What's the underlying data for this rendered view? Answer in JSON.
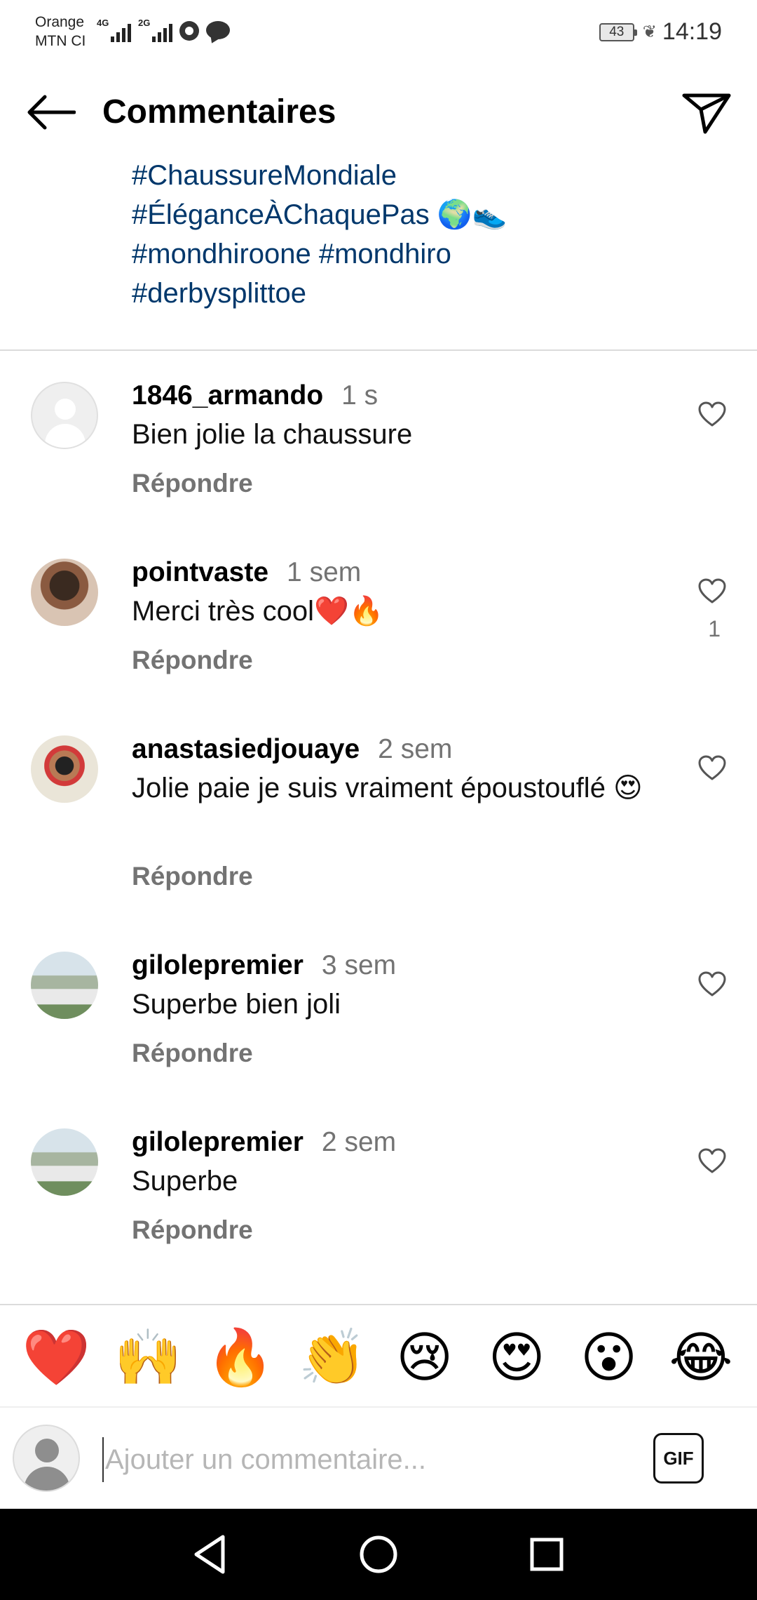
{
  "status_bar": {
    "carrier_line1": "Orange",
    "carrier_line2": "MTN CI",
    "net1": "4G",
    "net2": "2G",
    "battery": "43",
    "time": "14:19"
  },
  "header": {
    "title": "Commentaires"
  },
  "caption": {
    "lines": [
      "#ChaussureMondiale",
      "#ÉléganceÀChaquePas 🌍👟",
      "#mondhiroone #mondhiro",
      "#derbysplittoe"
    ]
  },
  "comments": [
    {
      "username": "1846_armando",
      "time": "1 s",
      "text": "Bien jolie la chaussure",
      "reply": "Répondre",
      "likes": ""
    },
    {
      "username": "pointvaste",
      "time": "1 sem",
      "text": "Merci très cool❤️🔥",
      "reply": "Répondre",
      "likes": "1"
    },
    {
      "username": "anastasiedjouaye",
      "time": "2 sem",
      "text": "Jolie paie je suis vraiment époustouflé 😍",
      "reply": "Répondre",
      "likes": ""
    },
    {
      "username": "gilolepremier",
      "time": "3 sem",
      "text": "Superbe bien joli",
      "reply": "Répondre",
      "likes": ""
    },
    {
      "username": "gilolepremier",
      "time": "2 sem",
      "text": "Superbe",
      "reply": "Répondre",
      "likes": ""
    }
  ],
  "emoji_bar": [
    "❤️",
    "🙌",
    "🔥",
    "👏",
    "😢",
    "😍",
    "😮",
    "😂"
  ],
  "input": {
    "placeholder": "Ajouter un commentaire...",
    "gif_label": "GIF"
  }
}
